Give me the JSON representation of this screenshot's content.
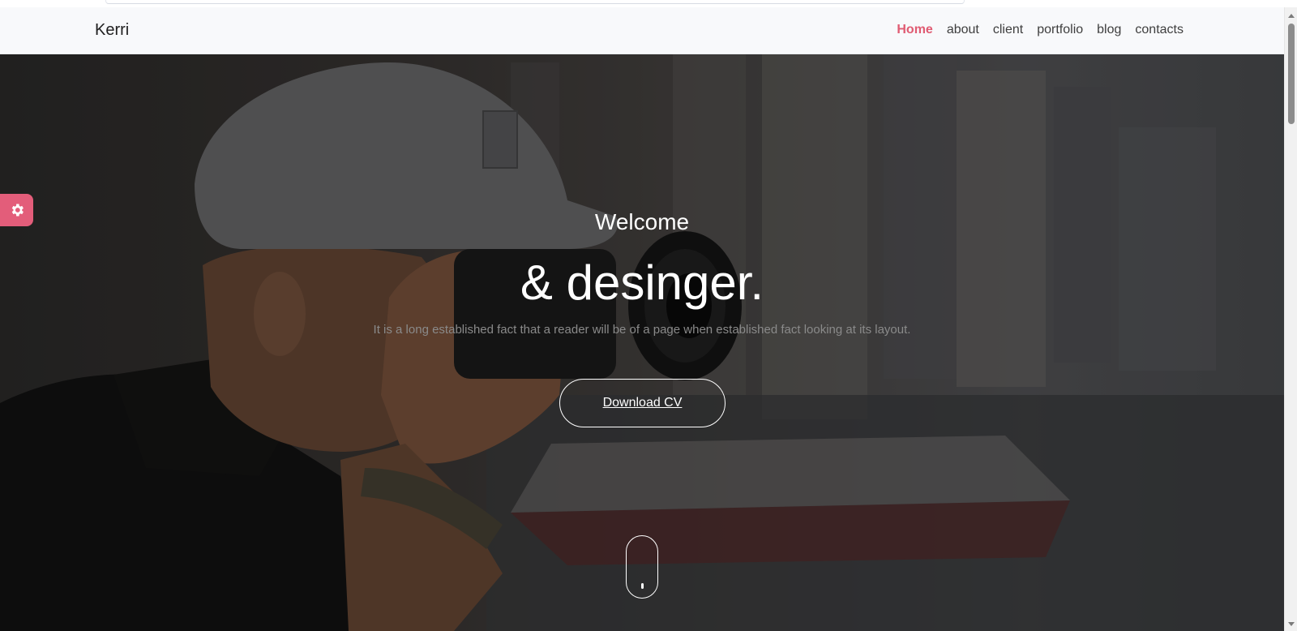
{
  "nav": {
    "brand": "Kerri",
    "links": [
      {
        "label": "Home",
        "active": true
      },
      {
        "label": "about",
        "active": false
      },
      {
        "label": "client",
        "active": false
      },
      {
        "label": "portfolio",
        "active": false
      },
      {
        "label": "blog",
        "active": false
      },
      {
        "label": "contacts",
        "active": false
      }
    ]
  },
  "hero": {
    "welcome": "Welcome",
    "headline": "& desinger.",
    "lead": "It is a long established fact that a reader will be of a page when established fact looking at its layout.",
    "button_label": "Download CV"
  },
  "icons": {
    "settings": "gear-icon",
    "scroll": "mouse-scroll-icon"
  },
  "colors": {
    "accent": "#e05b72",
    "settings_tab": "#e35d7a",
    "nav_bg": "#f8f9fb",
    "hero_text": "#ffffff"
  }
}
